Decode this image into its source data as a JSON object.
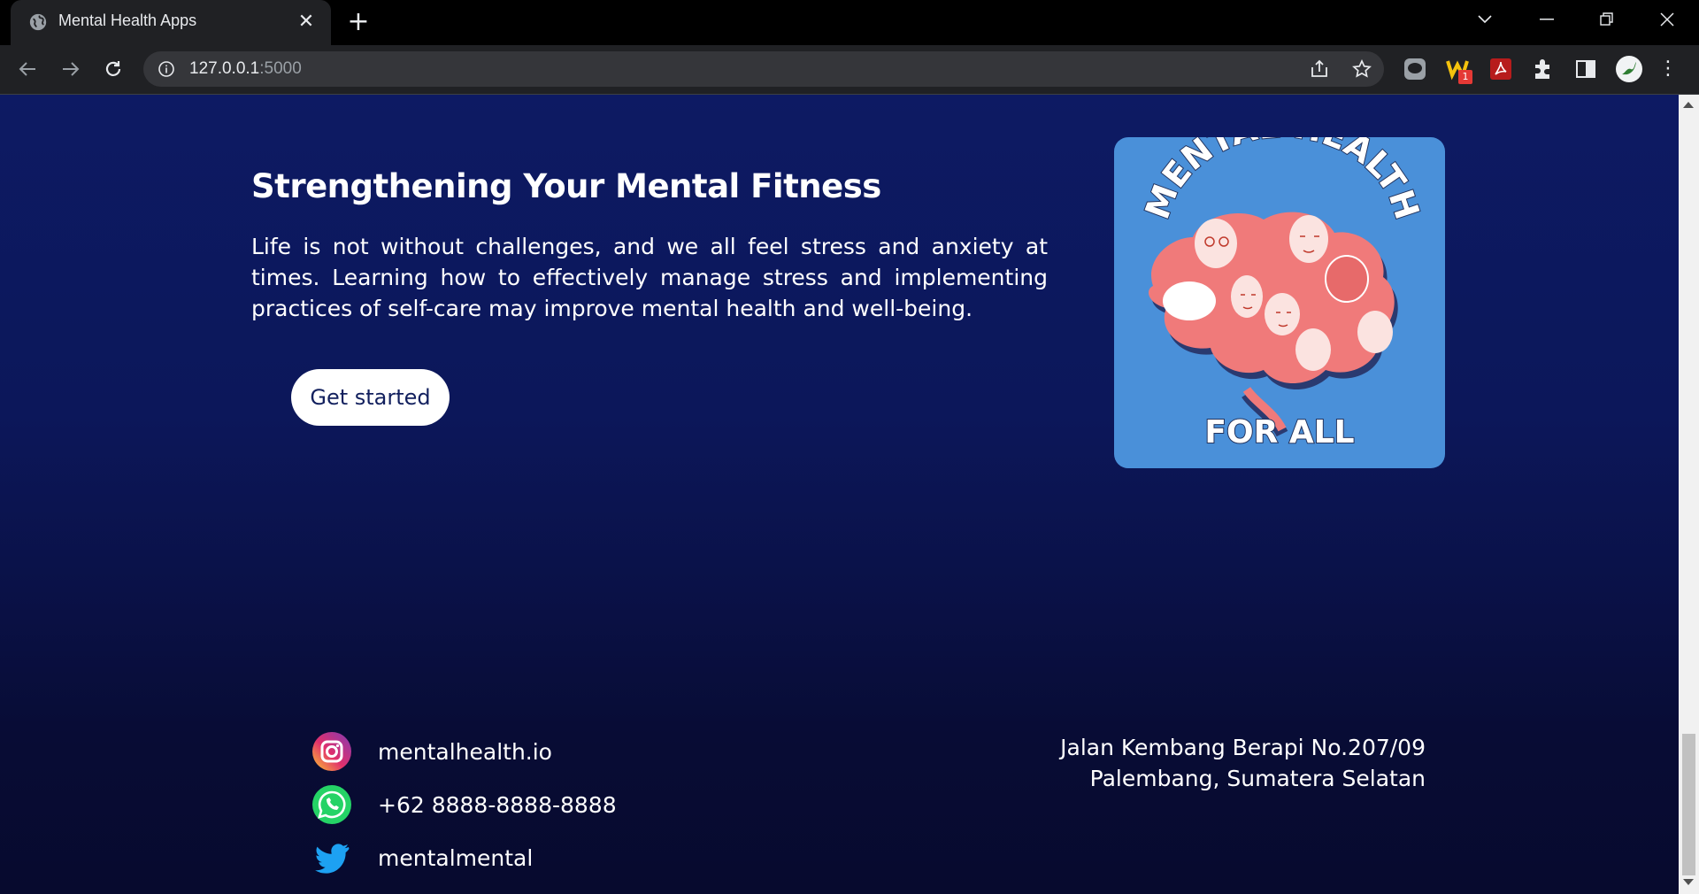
{
  "browser": {
    "tab_title": "Mental Health Apps",
    "url_host": "127.0.0.1",
    "url_port": ":5000",
    "extension_badge": "1"
  },
  "hero": {
    "title": "Strengthening Your Mental Fitness",
    "text": "Life is not without challenges, and we all feel stress and anxiety at times. Learning how to effectively manage stress and implementing practices of self-care may improve mental health and well-being.",
    "cta_label": "Get started",
    "poster_top_text": "MENTAL HEALTH",
    "poster_bottom_text": "FOR ALL"
  },
  "footer": {
    "social": [
      {
        "icon": "instagram-icon",
        "label": "mentalhealth.io"
      },
      {
        "icon": "whatsapp-icon",
        "label": "+62 8888-8888-8888"
      },
      {
        "icon": "twitter-icon",
        "label": "mentalmental"
      }
    ],
    "address_line1": "Jalan Kembang Berapi No.207/09",
    "address_line2": "Palembang, Sumatera Selatan"
  },
  "colors": {
    "page_bg_top": "#0d1a63",
    "page_bg_bottom": "#070a2e",
    "poster_bg": "#4a90d9",
    "poster_brain": "#f07a7a"
  }
}
